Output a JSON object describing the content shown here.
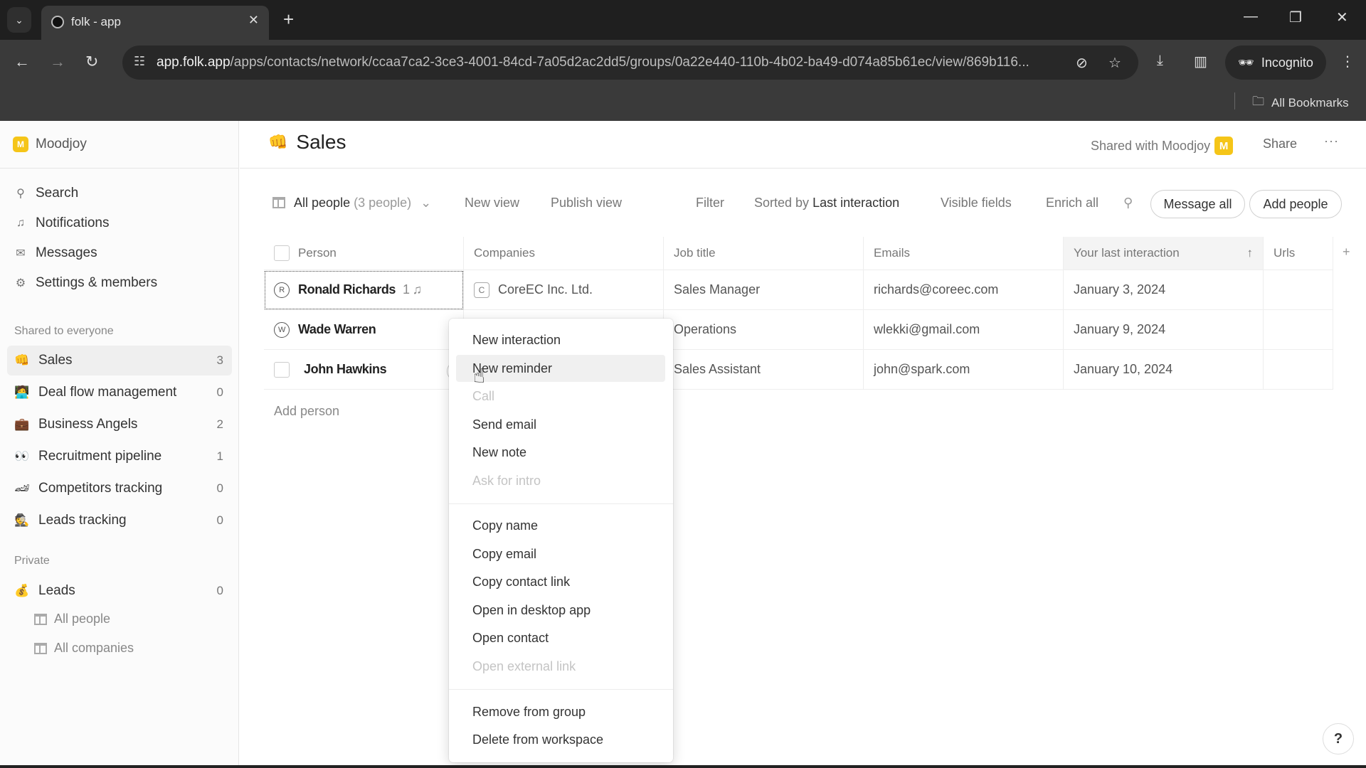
{
  "browser": {
    "tab_title": "folk - app",
    "url_host": "app.folk.app",
    "url_path": "/apps/contacts/network/ccaa7ca2-3ce3-4001-84cd-7a05d2ac2dd5/groups/0a22e440-110b-4b02-ba49-d074a85b61ec/view/869b116...",
    "incognito_label": "Incognito",
    "bookmarks_label": "All Bookmarks"
  },
  "sidebar": {
    "workspace": {
      "badge": "M",
      "name": "Moodjoy"
    },
    "nav": [
      {
        "icon": "search-icon",
        "glyph": "⚲",
        "label": "Search"
      },
      {
        "icon": "bell-icon",
        "glyph": "🔔︎",
        "label": "Notifications"
      },
      {
        "icon": "mail-icon",
        "glyph": "✉",
        "label": "Messages"
      },
      {
        "icon": "gear-icon",
        "glyph": "⚙",
        "label": "Settings & members"
      }
    ],
    "shared_section": "Shared to everyone",
    "shared_groups": [
      {
        "emoji": "👊",
        "label": "Sales",
        "count": "3",
        "active": true
      },
      {
        "emoji": "🧑‍💻",
        "label": "Deal flow management",
        "count": "0"
      },
      {
        "emoji": "💼",
        "label": "Business Angels",
        "count": "2"
      },
      {
        "emoji": "👀",
        "label": "Recruitment pipeline",
        "count": "1"
      },
      {
        "emoji": "🏎",
        "label": "Competitors tracking",
        "count": "0"
      },
      {
        "emoji": "🕵",
        "label": "Leads tracking",
        "count": "0"
      }
    ],
    "private_section": "Private",
    "private_groups": [
      {
        "emoji": "💰",
        "label": "Leads",
        "count": "0"
      }
    ],
    "private_views": [
      {
        "label": "All people"
      },
      {
        "label": "All companies"
      }
    ]
  },
  "page": {
    "emoji": "👊",
    "title": "Sales",
    "shared_with": "Shared with Moodjoy",
    "shared_badge": "M",
    "share_label": "Share",
    "more_label": "···"
  },
  "toolbar": {
    "view_name": "All people",
    "view_count": "(3 people)",
    "new_view": "New view",
    "publish_view": "Publish view",
    "filter": "Filter",
    "sorted_prefix": "Sorted by",
    "sorted_field": "Last interaction",
    "visible_fields": "Visible fields",
    "enrich_all": "Enrich all",
    "message_all": "Message all",
    "add_people": "Add people"
  },
  "table": {
    "columns": [
      "Person",
      "Companies",
      "Job title",
      "Emails",
      "Your last interaction",
      "Urls"
    ],
    "sort_indicator": "↑",
    "rows": [
      {
        "avatar": "R",
        "person": "Ronald Richards",
        "reminders": "1",
        "company_initial": "C",
        "company": "CoreEC Inc. Ltd.",
        "job_title": "Sales Manager",
        "email": "richards@coreec.com",
        "last_interaction": "January 3, 2024",
        "urls": ""
      },
      {
        "avatar": "W",
        "person": "Wade Warren",
        "company_initial": "",
        "company": "",
        "job_title": "Operations",
        "email": "wlekki@gmail.com",
        "last_interaction": "January 9, 2024",
        "urls": ""
      },
      {
        "avatar": "",
        "person": "John Hawkins",
        "company_initial": "",
        "company": "",
        "job_title": "Sales Assistant",
        "email": "john@spark.com",
        "last_interaction": "January 10, 2024",
        "urls": ""
      }
    ],
    "add_person": "Add person",
    "add_column": "+"
  },
  "context_menu": {
    "items": [
      {
        "label": "New interaction",
        "state": "enabled"
      },
      {
        "label": "New reminder",
        "state": "hover"
      },
      {
        "label": "Call",
        "state": "disabled"
      },
      {
        "label": "Send email",
        "state": "enabled"
      },
      {
        "label": "New note",
        "state": "enabled"
      },
      {
        "label": "Ask for intro",
        "state": "disabled"
      },
      {
        "label": "Copy name",
        "state": "enabled"
      },
      {
        "label": "Copy email",
        "state": "enabled"
      },
      {
        "label": "Copy contact link",
        "state": "enabled"
      },
      {
        "label": "Open in desktop app",
        "state": "enabled"
      },
      {
        "label": "Open contact",
        "state": "enabled"
      },
      {
        "label": "Open external link",
        "state": "disabled"
      },
      {
        "label": "Remove from group",
        "state": "enabled"
      },
      {
        "label": "Delete from workspace",
        "state": "enabled"
      }
    ]
  },
  "help_label": "?",
  "colors": {
    "brand_yellow": "#f5c518",
    "hover_bg": "#f0f0f0",
    "disabled_text": "#c4c4c4"
  }
}
